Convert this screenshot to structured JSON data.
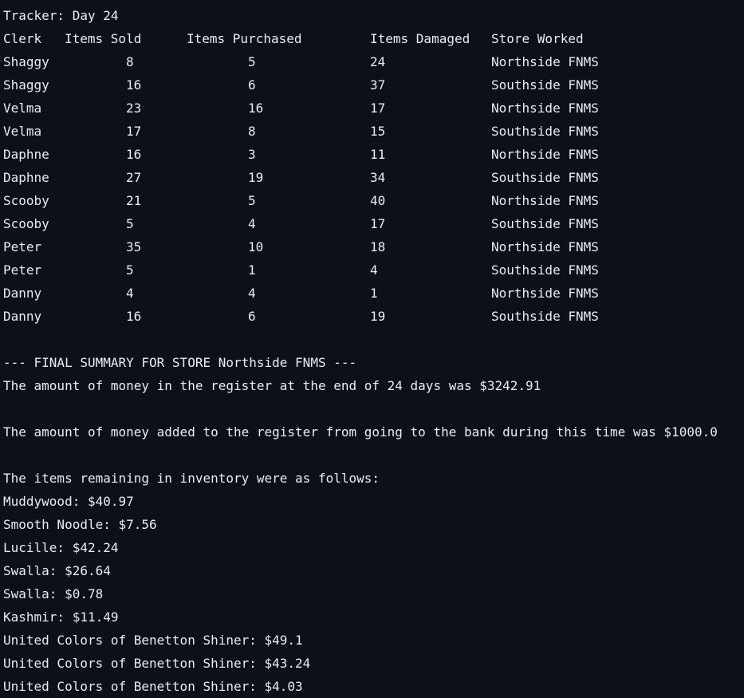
{
  "tracker_title": "Tracker: Day 24",
  "table": {
    "headers": [
      "Clerk",
      "Items Sold",
      "Items Purchased",
      "Items Damaged",
      "Store Worked"
    ],
    "rows": [
      [
        "Shaggy",
        "8",
        "5",
        "24",
        "Northside FNMS"
      ],
      [
        "Shaggy",
        "16",
        "6",
        "37",
        "Southside FNMS"
      ],
      [
        "Velma",
        "23",
        "16",
        "17",
        "Northside FNMS"
      ],
      [
        "Velma",
        "17",
        "8",
        "15",
        "Southside FNMS"
      ],
      [
        "Daphne",
        "16",
        "3",
        "11",
        "Northside FNMS"
      ],
      [
        "Daphne",
        "27",
        "19",
        "34",
        "Southside FNMS"
      ],
      [
        "Scooby",
        "21",
        "5",
        "40",
        "Northside FNMS"
      ],
      [
        "Scooby",
        "5",
        "4",
        "17",
        "Southside FNMS"
      ],
      [
        "Peter",
        "35",
        "10",
        "18",
        "Northside FNMS"
      ],
      [
        "Peter",
        "5",
        "1",
        "4",
        "Southside FNMS"
      ],
      [
        "Danny",
        "4",
        "4",
        "1",
        "Northside FNMS"
      ],
      [
        "Danny",
        "16",
        "6",
        "19",
        "Southside FNMS"
      ]
    ]
  },
  "summary": {
    "heading": "--- FINAL SUMMARY FOR STORE Northside FNMS ---",
    "register_line": "The amount of money in the register at the end of 24 days was $3242.91",
    "bank_line": "The amount of money added to the register from going to the bank during this time was $1000.0",
    "inventory_intro": "The items remaining in inventory were as follows:",
    "inventory": [
      "Muddywood: $40.97",
      "Smooth Noodle: $7.56",
      "Lucille: $42.24",
      "Swalla: $26.64",
      "Swalla: $0.78",
      "Kashmir: $11.49",
      "United Colors of Benetton Shiner: $49.1",
      "United Colors of Benetton Shiner: $43.24",
      "United Colors of Benetton Shiner: $4.03"
    ]
  }
}
